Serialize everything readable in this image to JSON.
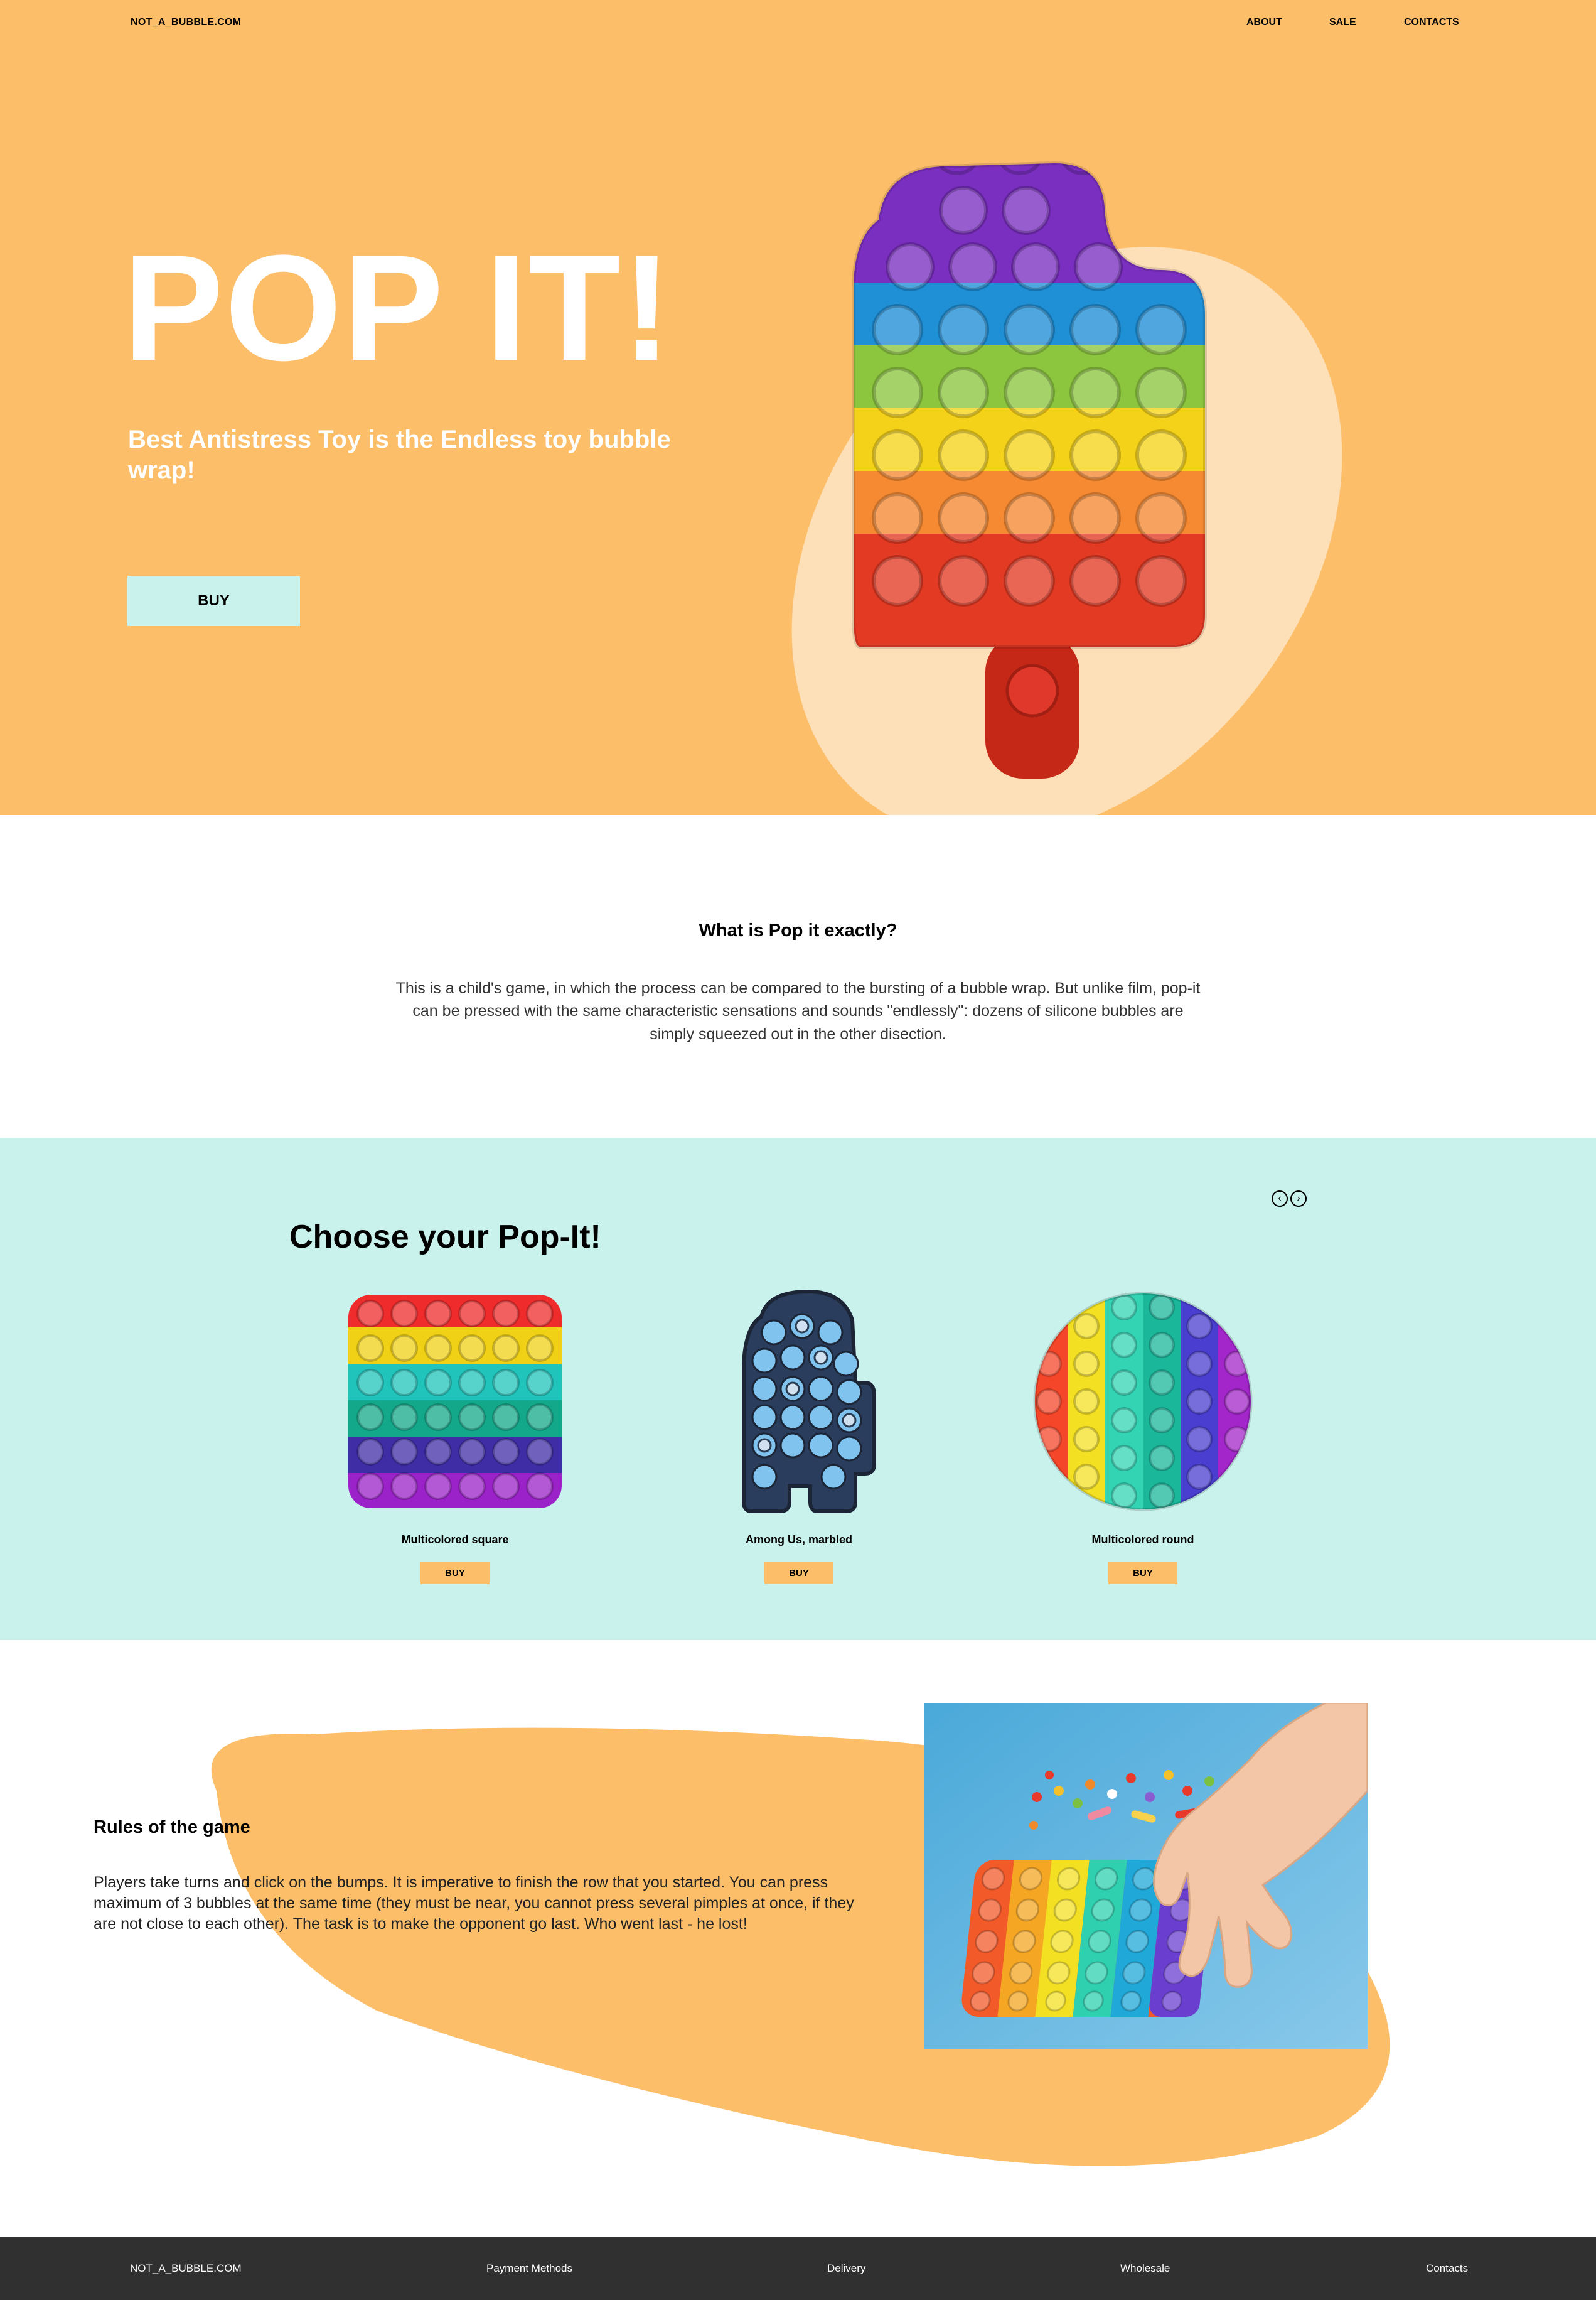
{
  "header": {
    "brand": "NOT_A_BUBBLE.COM",
    "nav": [
      "ABOUT",
      "SALE",
      "CONTACTS"
    ]
  },
  "hero": {
    "title": "POP IT!",
    "subtitle": "Best Antistress Toy is the Endless toy bubble wrap!",
    "buy_label": "BUY"
  },
  "what": {
    "title": "What is Pop it exactly?",
    "text": "This is a child's game, in which the process can be compared to the bursting of a bubble wrap. But unlike film, pop-it can be pressed with the same characteristic sensations and sounds \"endlessly\": dozens of silicone bubbles are simply squeezed out in the other disection."
  },
  "choose": {
    "title": "Choose your Pop-It!",
    "prev_icon": "chevron-left-icon",
    "next_icon": "chevron-right-icon",
    "products": [
      {
        "name": "Multicolored square",
        "buy_label": "BUY"
      },
      {
        "name": "Among Us, marbled",
        "buy_label": "BUY"
      },
      {
        "name": "Multicolored round",
        "buy_label": "BUY"
      }
    ]
  },
  "rules": {
    "title": "Rules of the game",
    "text": "Players take turns and click on the bumps. It is imperative to finish the row that you started. You can press maximum of 3 bubbles at the same time (they must be near, you cannot press several pimples at once, if they are not close to each other). The task is to make the opponent go last. Who went last - he lost!"
  },
  "footer": {
    "brand": "NOT_A_BUBBLE.COM",
    "links": [
      "Payment Methods",
      "Delivery",
      "Wholesale",
      "Contacts"
    ]
  },
  "colors": {
    "accent_orange": "#fdbe69",
    "accent_mint": "#c9f2ec",
    "footer_bg": "#303030"
  }
}
